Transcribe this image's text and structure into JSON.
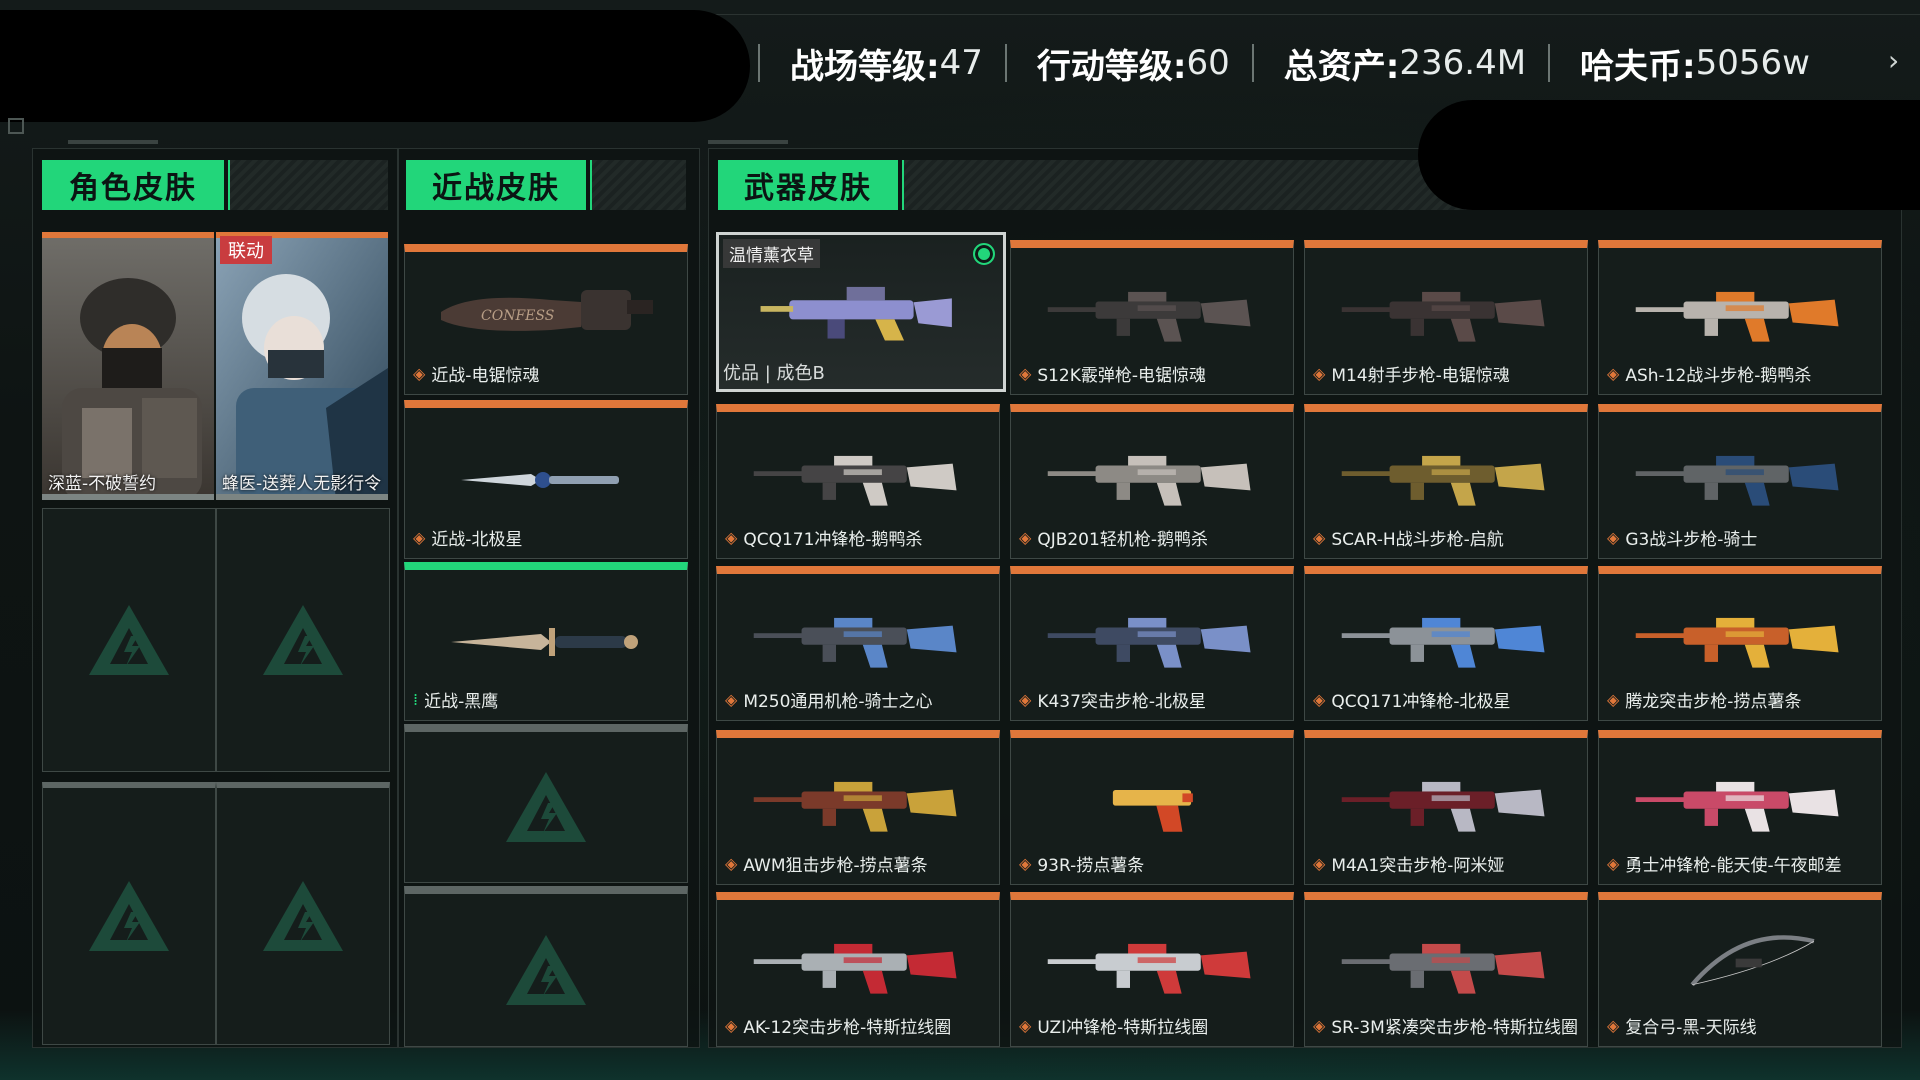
{
  "header": {
    "stats": [
      {
        "label": "战场等级:",
        "value": "47"
      },
      {
        "label": "行动等级:",
        "value": "60"
      },
      {
        "label": "总资产:",
        "value": "236.4M"
      },
      {
        "label": "哈夫币:",
        "value": "5056w"
      }
    ],
    "next_icon": "chevron-right-icon"
  },
  "tabs": {
    "character": "角色皮肤",
    "melee": "近战皮肤",
    "weapon": "武器皮肤"
  },
  "characters": [
    {
      "name": "深蓝-不破誓约",
      "badge": ""
    },
    {
      "name": "蜂医-送葬人无影行令",
      "badge": "联动"
    }
  ],
  "melee": [
    {
      "name": "近战-电锯惊魂",
      "rarity_color": "#e0773a"
    },
    {
      "name": "近战-北极星",
      "rarity_color": "#e0773a"
    },
    {
      "name": "近战-黑鹰",
      "rarity_color": "#22d67a"
    }
  ],
  "selected_weapon": {
    "name": "温情薰衣草",
    "quality": "优品 | 成色B"
  },
  "weapons": [
    {
      "name": "S12K霰弹枪-电锯惊魂"
    },
    {
      "name": "M14射手步枪-电锯惊魂"
    },
    {
      "name": "ASh-12战斗步枪-鹅鸭杀"
    },
    {
      "name": "QCQ171冲锋枪-鹅鸭杀"
    },
    {
      "name": "QJB201轻机枪-鹅鸭杀"
    },
    {
      "name": "SCAR-H战斗步枪-启航"
    },
    {
      "name": "G3战斗步枪-骑士"
    },
    {
      "name": "M250通用机枪-骑士之心"
    },
    {
      "name": "K437突击步枪-北极星"
    },
    {
      "name": "QCQ171冲锋枪-北极星"
    },
    {
      "name": "腾龙突击步枪-捞点薯条"
    },
    {
      "name": "AWM狙击步枪-捞点薯条"
    },
    {
      "name": "93R-捞点薯条"
    },
    {
      "name": "M4A1突击步枪-阿米娅"
    },
    {
      "name": "勇士冲锋枪-能天使-午夜邮差"
    },
    {
      "name": "AK-12突击步枪-特斯拉线圈"
    },
    {
      "name": "UZI冲锋枪-特斯拉线圈"
    },
    {
      "name": "SR-3M紧凑突击步枪-特斯拉线圈"
    },
    {
      "name": "复合弓-黑-天际线"
    }
  ],
  "colors": {
    "accent": "#22d67a",
    "rarity_orange": "#e0773a"
  }
}
